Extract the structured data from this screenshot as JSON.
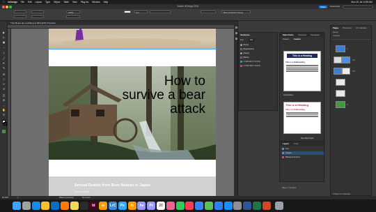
{
  "menubar": {
    "apple": "",
    "app": "InDesign",
    "items": [
      "File",
      "Edit",
      "Layout",
      "Type",
      "Object",
      "Table",
      "View",
      "Plug-ins",
      "Window",
      "Help"
    ],
    "clock": "Mon 20 Jul  10:55 AM"
  },
  "window": {
    "title": "Adobe InDesign 2024",
    "share": "Share",
    "workspace": "Essentials",
    "search_placeholder": "Search"
  },
  "controlbar": {
    "zoom_value": "100%",
    "stroke_value": "0 pt",
    "font_value": "Base Graphics Frame]"
  },
  "document": {
    "tab_label": "*The Bears ate a pitfaling at 69% [GPU Preview]"
  },
  "canvas": {
    "headline": "How to survive a bear attack",
    "bottom_title": "Annual Deaths from Bear Attacks in Japan",
    "bottom_sub": "Some caption"
  },
  "swatches": {
    "title": "Swatches",
    "tint": "Tint:",
    "tint_value": "100",
    "items": [
      {
        "name": "[None]",
        "color": "#ffffff"
      },
      {
        "name": "[Registration]",
        "color": "#000000"
      },
      {
        "name": "[Paper]",
        "color": "#ffffff"
      },
      {
        "name": "[Black]",
        "color": "#000000"
      },
      {
        "name": "C=100 M=0 Y=0 K=0",
        "color": "#00a0e9"
      },
      {
        "name": "C=0 M=100 Y=0 K=0",
        "color": "#e4007f"
      }
    ]
  },
  "styles": {
    "tabs": [
      "Style Packs",
      "Character",
      "Paragraph"
    ],
    "subtabs": [
      "Presets",
      "Custom"
    ],
    "card1": {
      "heading": "This is a Heading",
      "sub": "This is a Subheading"
    },
    "card1_label": "Atmosphere",
    "card2": {
      "heading": "This is a Heading",
      "sub": "This is a Subheading"
    },
    "new_style": "New Style Pack"
  },
  "layers": {
    "tabs": [
      "Layers",
      "Links"
    ],
    "rows": [
      {
        "name": "Text",
        "color": "#4a90e2"
      },
      {
        "name": "Images",
        "color": "#4a90e2"
      },
      {
        "name": "Background items",
        "color": "#e24a4a"
      }
    ],
    "footer": "Page: 2, 3 Layers"
  },
  "pages": {
    "tabs": [
      "Pages",
      "Properties",
      "CC Libraries"
    ],
    "none": "[None]",
    "apage": "A-Parent",
    "footer": "6 Pages in 4 Spreads",
    "numbers": [
      "1",
      "2-3",
      "4-5",
      "6"
    ]
  },
  "statusbar": {
    "zoom": "69.48%",
    "page": "1",
    "profile": "[Basic] (working)",
    "errors": "No errors"
  },
  "dock": {
    "icons": [
      {
        "name": "finder",
        "color": "#3fa3ff"
      },
      {
        "name": "launchpad",
        "color": "#a0a0a0"
      },
      {
        "name": "safari",
        "color": "#1e88e5"
      },
      {
        "name": "chrome",
        "color": "#f2c12e"
      },
      {
        "name": "vscode",
        "color": "#0a6fc2"
      },
      {
        "name": "firefox",
        "color": "#ff7a00"
      },
      {
        "name": "notes",
        "color": "#f2d85b"
      },
      {
        "name": "terminal",
        "color": "#2b2b2b"
      },
      {
        "name": "id",
        "color": "#49021f"
      },
      {
        "name": "ai",
        "color": "#ff9a00"
      },
      {
        "name": "lrc",
        "color": "#3a8ad6"
      },
      {
        "name": "ps",
        "color": "#31a8ff"
      },
      {
        "name": "ai2",
        "color": "#ff9a00"
      },
      {
        "name": "ae",
        "color": "#9999ff"
      },
      {
        "name": "pr",
        "color": "#9999ff"
      },
      {
        "name": "calendar",
        "color": "#ffffff"
      },
      {
        "name": "photos",
        "color": "#f06292"
      },
      {
        "name": "messages",
        "color": "#34c759"
      },
      {
        "name": "music",
        "color": "#fa3b5a"
      },
      {
        "name": "mail",
        "color": "#3b82f6"
      },
      {
        "name": "maps",
        "color": "#5bbf5b"
      },
      {
        "name": "xcode",
        "color": "#2d7ef7"
      },
      {
        "name": "appstore",
        "color": "#1a8cff"
      },
      {
        "name": "settings",
        "color": "#8e8e93"
      },
      {
        "name": "word",
        "color": "#2b579a"
      },
      {
        "name": "excel",
        "color": "#217346"
      },
      {
        "name": "ppt",
        "color": "#d24726"
      },
      {
        "name": "trash",
        "color": "#9aa0a6"
      }
    ],
    "labels": {
      "id": "Id",
      "ai": "Ai",
      "lrc": "LrC",
      "ps": "Ps",
      "ai2": "Ai",
      "ae": "Ae",
      "pr": "Pr",
      "calendar": "20"
    }
  }
}
